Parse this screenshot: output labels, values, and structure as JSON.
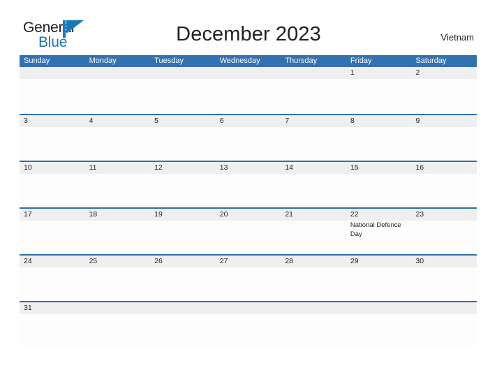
{
  "brand": {
    "name_part1": "General",
    "name_part2": "Blue",
    "flag_icon": "blue-flag-triangle-icon",
    "color_dark": "#231f20",
    "color_blue": "#1878be"
  },
  "header": {
    "title": "December 2023",
    "country": "Vietnam"
  },
  "theme": {
    "header_blue": "#3372b0",
    "divider_blue": "#2f6fae",
    "date_band_gray": "#efefef",
    "cell_white": "#fdfdfd",
    "text_dark": "#231f20"
  },
  "calendar": {
    "month": "December",
    "year": "2023",
    "weekday_headers": [
      "Sunday",
      "Monday",
      "Tuesday",
      "Wednesday",
      "Thursday",
      "Friday",
      "Saturday"
    ],
    "weeks": [
      [
        {
          "day": "",
          "events": []
        },
        {
          "day": "",
          "events": []
        },
        {
          "day": "",
          "events": []
        },
        {
          "day": "",
          "events": []
        },
        {
          "day": "",
          "events": []
        },
        {
          "day": "1",
          "events": []
        },
        {
          "day": "2",
          "events": []
        }
      ],
      [
        {
          "day": "3",
          "events": []
        },
        {
          "day": "4",
          "events": []
        },
        {
          "day": "5",
          "events": []
        },
        {
          "day": "6",
          "events": []
        },
        {
          "day": "7",
          "events": []
        },
        {
          "day": "8",
          "events": []
        },
        {
          "day": "9",
          "events": []
        }
      ],
      [
        {
          "day": "10",
          "events": []
        },
        {
          "day": "11",
          "events": []
        },
        {
          "day": "12",
          "events": []
        },
        {
          "day": "13",
          "events": []
        },
        {
          "day": "14",
          "events": []
        },
        {
          "day": "15",
          "events": []
        },
        {
          "day": "16",
          "events": []
        }
      ],
      [
        {
          "day": "17",
          "events": []
        },
        {
          "day": "18",
          "events": []
        },
        {
          "day": "19",
          "events": []
        },
        {
          "day": "20",
          "events": []
        },
        {
          "day": "21",
          "events": []
        },
        {
          "day": "22",
          "events": [
            "National Defence Day"
          ]
        },
        {
          "day": "23",
          "events": []
        }
      ],
      [
        {
          "day": "24",
          "events": []
        },
        {
          "day": "25",
          "events": []
        },
        {
          "day": "26",
          "events": []
        },
        {
          "day": "27",
          "events": []
        },
        {
          "day": "28",
          "events": []
        },
        {
          "day": "29",
          "events": []
        },
        {
          "day": "30",
          "events": []
        }
      ],
      [
        {
          "day": "31",
          "events": []
        },
        {
          "day": "",
          "events": []
        },
        {
          "day": "",
          "events": []
        },
        {
          "day": "",
          "events": []
        },
        {
          "day": "",
          "events": []
        },
        {
          "day": "",
          "events": []
        },
        {
          "day": "",
          "events": []
        }
      ]
    ]
  }
}
